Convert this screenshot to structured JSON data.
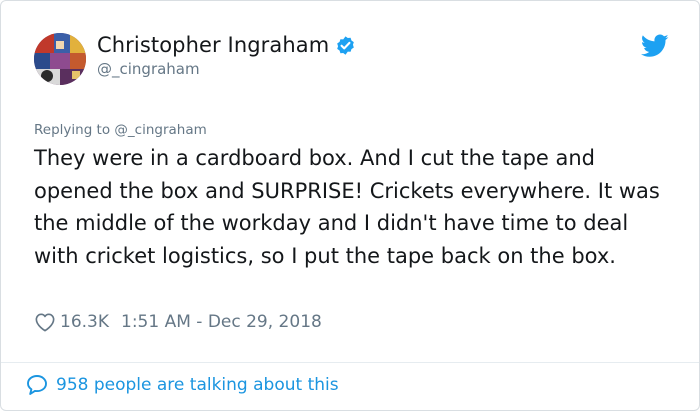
{
  "tweet": {
    "author": {
      "display_name": "Christopher Ingraham",
      "handle": "@_cingraham",
      "verified": true,
      "avatar_icon": "avatar-collage"
    },
    "reply_to": "Replying to @_cingraham",
    "text": "They were in a cardboard box. And I cut the tape and opened the box and SURPRISE! Crickets everywhere. It was the middle of the workday and I didn't have time to deal with cricket logistics, so I put the tape back on the box.",
    "likes": "16.3K",
    "timestamp": "1:51 AM - Dec 29, 2018",
    "talking": "958 people are talking about this"
  },
  "icons": {
    "platform": "twitter-bird-icon",
    "verified": "verified-badge-icon",
    "like": "heart-icon",
    "conversation": "speech-bubble-icon"
  },
  "colors": {
    "accent": "#1da1f2",
    "link": "#1b95e0",
    "secondary_text": "#657786",
    "primary_text": "#14171a",
    "border": "#d9dee2"
  }
}
